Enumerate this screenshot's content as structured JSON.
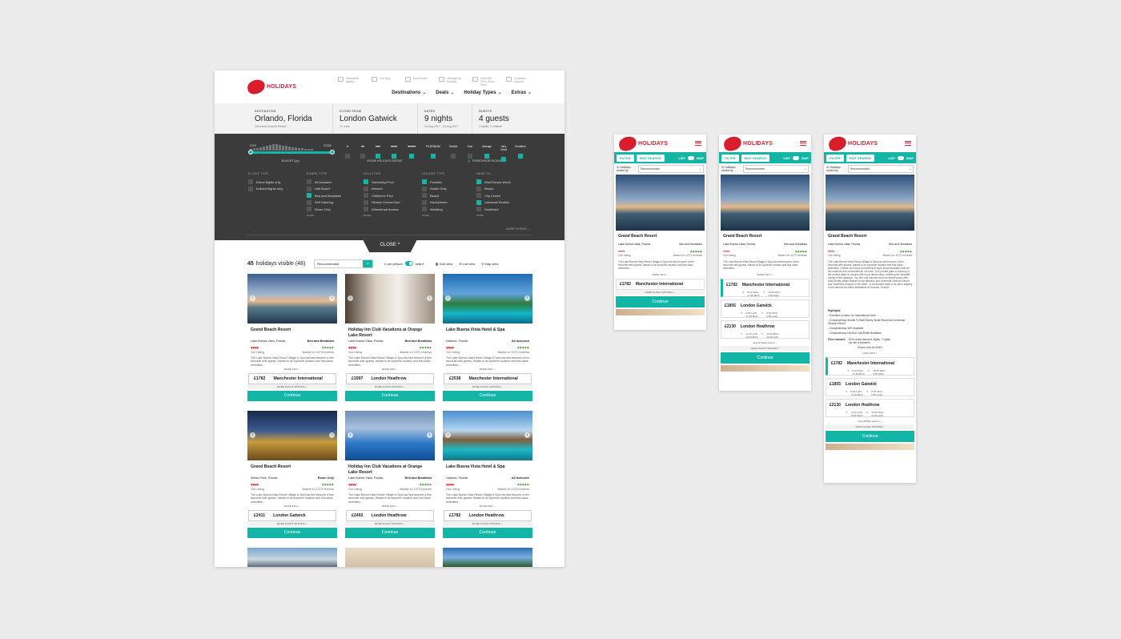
{
  "brand": {
    "word": "HOLIDAYS",
    "badge": "Virgin",
    "accent": "#d81e2c",
    "teal": "#12b5a6"
  },
  "utility": [
    {
      "label": "Newsletter signup",
      "icon": "mail-icon"
    },
    {
      "label": "Our blog",
      "icon": "blog-icon"
    },
    {
      "label": "Store finder",
      "icon": "store-icon"
    },
    {
      "label": "Manage my booking",
      "icon": "booking-icon"
    },
    {
      "label": "0344 557 4321 (9am - 9pm)",
      "icon": "phone-icon"
    },
    {
      "label": "Customer support",
      "icon": "support-icon"
    }
  ],
  "nav": [
    "Destinations",
    "Deals",
    "Holiday Types",
    "Extras"
  ],
  "search": {
    "destination": {
      "key": "DESTINATION",
      "value": "Orlando, Florida",
      "sub": "Universal Orlando Resort"
    },
    "from": {
      "key": "FLYING FROM",
      "value": "London Gatwick",
      "sub": "+1 more"
    },
    "dates": {
      "key": "DATES",
      "value": "9 nights",
      "sub": "14 Aug 2017 - 24 Aug 2017"
    },
    "guests": {
      "key": "GUESTS",
      "value": "4 guests",
      "sub": "2 adults, 2 children"
    }
  },
  "filters": {
    "budget_min": "£100",
    "budget_max": "£2250",
    "budget_label": "BUDGET (pp)",
    "virgin_label": "VIRGIN HOLIDAYS RATING",
    "trip_label": "TRIPADVISOR RATING",
    "trip_levels": [
      "Terrible",
      "Poor",
      "Average",
      "Very Good",
      "Excellent"
    ],
    "platinum": "PLATINUM",
    "flight_type": {
      "h": "FLIGHT TYPE",
      "opts": [
        {
          "l": "Direct flights only",
          "on": false
        },
        {
          "l": "Indirect flights only",
          "on": false
        }
      ]
    },
    "board_type": {
      "h": "BOARD TYPE",
      "opts": [
        {
          "l": "All Inclusive",
          "on": false
        },
        {
          "l": "Half Board",
          "on": false
        },
        {
          "l": "Bed and Breakfast",
          "on": true
        },
        {
          "l": "Self Catering",
          "on": false
        },
        {
          "l": "Room Only",
          "on": false
        }
      ]
    },
    "facilities": {
      "h": "FACILITIES",
      "opts": [
        {
          "l": "Swimming Pool",
          "on": true
        },
        {
          "l": "Internet",
          "on": false
        },
        {
          "l": "Children's Pool",
          "on": false
        },
        {
          "l": "Fitness Centre/Gym",
          "on": false
        },
        {
          "l": "Wheelchair Access",
          "on": false
        }
      ]
    },
    "holiday_type": {
      "h": "HOLIDAY TYPE",
      "opts": [
        {
          "l": "Families",
          "on": true
        },
        {
          "l": "Adults Only",
          "on": false
        },
        {
          "l": "Beach",
          "on": false
        },
        {
          "l": "Honeymoon",
          "on": false
        },
        {
          "l": "Wedding",
          "on": false
        }
      ]
    },
    "near_to": {
      "h": "NEAR TO...",
      "opts": [
        {
          "l": "Walt Disney World",
          "on": true
        },
        {
          "l": "Beach",
          "on": false
        },
        {
          "l": "City Centre",
          "on": false
        },
        {
          "l": "Universal Studios",
          "on": true
        },
        {
          "l": "SeaWorld",
          "on": false
        }
      ]
    },
    "more": "MORE",
    "more_filters": "MORE FILTERS",
    "close": "CLOSE"
  },
  "results": {
    "count": "45",
    "visible_text": "holidays visible (48)",
    "sort": "Recommended",
    "per_person": "£ per person",
    "total": "total £",
    "grid": "Grid view",
    "list": "List view",
    "map": "Map view"
  },
  "cards": [
    {
      "title": "Grand Beach Resort",
      "loc": "Lake Buena Vista, Florida",
      "board": "Bed and Breakfast",
      "price": "£1782",
      "airport": "Manchester International",
      "img": "beach"
    },
    {
      "title": "Holiday Inn Club Vacations at Orange Lake Resort",
      "loc": "Lake Buena Vista, Florida",
      "board": "Bed and Breakfast",
      "price": "£1997",
      "airport": "London Heathrow",
      "img": "room"
    },
    {
      "title": "Lake Buena Vista Hotel & Spa",
      "loc": "Orlando, Florida",
      "board": "All Inclusive",
      "price": "£2538",
      "airport": "Manchester International",
      "img": "pool"
    },
    {
      "title": "Grand Beach Resort",
      "loc": "Winter Park, Florida",
      "board": "Room Only",
      "price": "£2411",
      "airport": "London Gatwick",
      "img": "night"
    },
    {
      "title": "Holiday Inn Club Vacations at Orange Lake Resort",
      "loc": "Lake Buena Vista, Florida",
      "board": "Bed and Breakfast",
      "price": "£2492",
      "airport": "London Heathrow",
      "img": "city"
    },
    {
      "title": "Lake Buena Vista Hotel & Spa",
      "loc": "Orlando, Florida",
      "board": "All Inclusive",
      "price": "£1782",
      "airport": "London Heathrow",
      "img": "villa"
    }
  ],
  "card_common": {
    "our_rating": "Our rating",
    "reviews": "Based on 1073 reviews",
    "desc": "The Lake Buena Vista Resort Village & Spa has fast become a firm favourite with guests, thanks to its supreme location and first-class amenities...",
    "more_info": "MORE INFO",
    "more_flight": "MORE FLIGHT OPTIONS",
    "continue": "Continue"
  },
  "mobile": {
    "filter": "FILTER",
    "edit": "EDIT SEARCH",
    "list": "LIST",
    "map": "MAP",
    "sorted": "41 holidays sorted by",
    "sort": "Recommended",
    "title": "Grand Beach Resort",
    "loc": "Lake Buena Vista, Florida",
    "board": "Bed and Breakfast",
    "desc_long": "The Lake Buena Vista Resort Village & Spa has fast become a firm favourite with guests, thanks to its supreme location and first-class amenities. Guests can enjoy condominium-style accommodation with all the comforts and conveniences of home. Your private patio or balcony is the perfect place to unwind with a pre-dinner drink, admiring the beautiful sunset in the distance. You are only minutes from the theme parks with Walt Disney World Resort in one direction and Universal Orlando Resort and SeaWorld Orlando in the other - a convenient area to be when staying in the famous fun-filled destination of Orlando, Florida!",
    "highlights_h": "Highlights",
    "highlights": [
      "- Excellent Location On International Drive",
      "- Complimentary Shuttle To Walt Disney World Resort and Universal Orlando Resort",
      "- Complimentary WiFi Available",
      "- Complimentary Hot And Cold Buffet Breakfast"
    ],
    "price_includes": "Price includes",
    "includes_text": "£126 online discount, flights, 7 nights, car hire & transfers",
    "secure": "Secure now for ££301",
    "less_info": "LESS INFO",
    "view_all": "view all flight options",
    "less_flight": "LESS FLIGHT OPTIONS",
    "flights": [
      {
        "price": "£1782",
        "airport": "Manchester International",
        "t1": "8:01 MAN",
        "t2": "17:35 MCO",
        "t3": "18:35 MCO",
        "t4": "6:55 MAN"
      },
      {
        "price": "£1855",
        "airport": "London Gatwick",
        "t1": "8:05 LGW",
        "t2": "17:05 MCO",
        "t3": "8:35 MCO",
        "t4": "6:55 LGW"
      },
      {
        "price": "£2130",
        "airport": "London Heathrow",
        "t1": "12:10 LHR",
        "t2": "19:00 MCO",
        "t3": "16:30 MCO",
        "t4": "20:40 LHR"
      }
    ]
  }
}
